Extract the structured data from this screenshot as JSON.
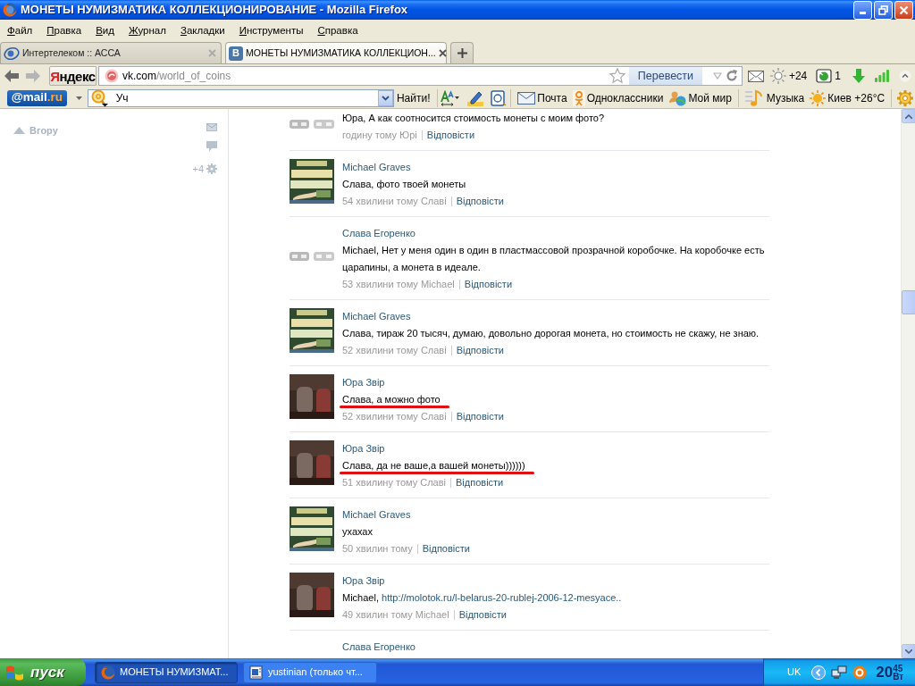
{
  "window": {
    "title": "МОНЕТЫ НУМИЗМАТИКА КОЛЛЕКЦИОНИРОВАНИЕ - Mozilla Firefox"
  },
  "menu": [
    "Файл",
    "Правка",
    "Вид",
    "Журнал",
    "Закладки",
    "Инструменты",
    "Справка"
  ],
  "tabs": [
    {
      "label": "Интертелеком :: АССА",
      "selected": false
    },
    {
      "label": "МОНЕТЫ НУМИЗМАТИКА КОЛЛЕКЦИОН...",
      "selected": true,
      "favicon_letter": "B"
    }
  ],
  "navbar": {
    "search_engine": "Яндекс",
    "url": {
      "host": "vk.com",
      "path": "/world_of_coins"
    },
    "translate": "Перевести",
    "weather": "+24",
    "notifications": "1"
  },
  "mailbar": {
    "logo": {
      "main": "@mail",
      "suffix": ".ru"
    },
    "search": {
      "value": "Уч"
    },
    "search_button": "Найти!",
    "links": [
      {
        "label": "Почта",
        "kind": "mail"
      },
      {
        "label": "Одноклассники",
        "kind": "ok"
      },
      {
        "label": "Мой мир",
        "kind": "world"
      },
      {
        "label": "Музыка",
        "kind": "music"
      },
      {
        "label": "Киев +26°C",
        "kind": "weather"
      }
    ]
  },
  "sidebar": {
    "back_to_top": "Вгору",
    "counter": "+4"
  },
  "comments": [
    {
      "kind": "logo",
      "text": "Юра, А как соотносится стоимость монеты с моим фото?",
      "time": "годину тому Юрі",
      "reply": "Відповісти",
      "underlined": false
    },
    {
      "kind": "poster",
      "author": "Michael Graves",
      "text": "Слава, фото твоей монеты",
      "time": "54 хвилини тому Славі",
      "reply": "Відповісти",
      "underlined": false
    },
    {
      "kind": "logo",
      "author": "Слава Егоренко",
      "text": "Michael, Нет у меня один в один в пластмассовой прозрачной коробочке. На коробочке есть царапины, а монета в идеале.",
      "time": "53 хвилини тому Michael",
      "reply": "Відповісти",
      "underlined": false
    },
    {
      "kind": "poster",
      "author": "Michael Graves",
      "text": "Слава, тираж 20 тысяч, думаю, довольно дорогая монета, но стоимость не скажу, не знаю.",
      "time": "52 хвилини тому Славі",
      "reply": "Відповісти",
      "underlined": false
    },
    {
      "kind": "photo",
      "author": "Юра Звір",
      "text": "Слава, а можно фото",
      "time": "52 хвилини тому Славі",
      "reply": "Відповісти",
      "underlined": true
    },
    {
      "kind": "photo",
      "author": "Юра Звір",
      "text": "Слава, да не ваше,а вашей монеты))))))",
      "time": "51 хвилину тому Славі",
      "reply": "Відповісти",
      "underlined": true
    },
    {
      "kind": "poster",
      "author": "Michael Graves",
      "text": "ухахах",
      "time": "50 хвилин тому",
      "reply": "Відповісти",
      "underlined": false
    },
    {
      "kind": "photo",
      "author": "Юра Звір",
      "text": "Michael,",
      "link": "http://molotok.ru/l-belarus-20-rublej-2006-12-mesyace..",
      "time": "49 хвилин тому Michael",
      "reply": "Відповісти",
      "underlined": false
    },
    {
      "author": "Слава Егоренко"
    }
  ],
  "taskbar": {
    "start": "пуск",
    "items": [
      {
        "label": "МОНЕТЫ НУМИЗМАТ...",
        "selected": true,
        "kind": "browser"
      },
      {
        "label": "yustinian (только чт...",
        "selected": false,
        "kind": "document"
      }
    ],
    "language": "UK",
    "clock": {
      "hours": "20",
      "minutes": "45",
      "day": "Вт"
    }
  }
}
